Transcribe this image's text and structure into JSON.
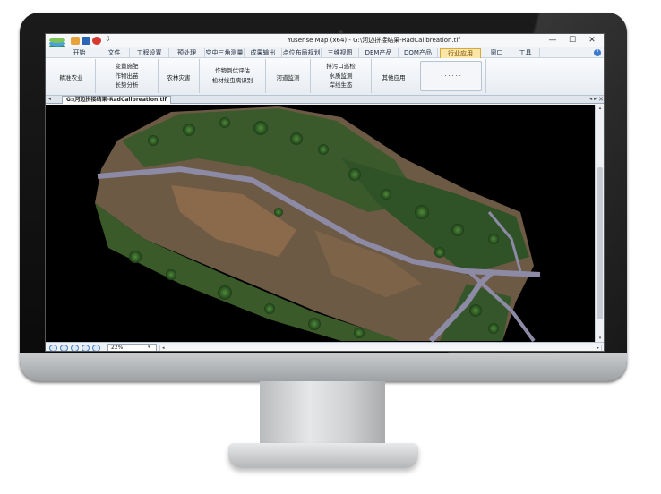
{
  "window": {
    "title": "Yusense Map (x64) - G:\\河边拼接结果-RadCalibreation.tif",
    "min_glyph": "—",
    "max_glyph": "☐",
    "close_glyph": "✕",
    "help_glyph": "?",
    "more_glyph": "⇩"
  },
  "menu_tabs": [
    "开始",
    "文件",
    "工程设置",
    "预处理",
    "空中三角测量",
    "成果输出",
    "点位布局规划",
    "三维视图",
    "DEM产品",
    "DOM产品",
    "行业应用",
    "窗口",
    "工具"
  ],
  "active_tab": "行业应用",
  "ribbon": {
    "precision_agri": "精准农业",
    "variable_fert": "变量施肥",
    "crop_seedling": "作物出苗",
    "growth_analysis": "长势分析",
    "agri_disaster": "农林灾害",
    "lodging_eval": "作物倒伏评估",
    "pine_disease": "松材线虫病识别",
    "river_monitor": "河道监测",
    "outfall_inspect": "排污口巡检",
    "water_quality": "水质监测",
    "shoreline": "岸线生态",
    "other_apps": "其他应用",
    "more": "· · · · · ·"
  },
  "document": {
    "tab_label": "G:\\河边拼接结果-RadCalibreation.tif",
    "left_arrow": "◂",
    "right_arrows": "◂ ▸",
    "close_glyph": "✕"
  },
  "statusbar": {
    "zoom_value": "22%",
    "dropdown_glyph": "▾",
    "left_arrow": "◂",
    "right_arrow": "▸"
  },
  "scrollbar": {
    "up": "▴",
    "down": "▾"
  },
  "icons": [
    "app-logo-icon",
    "folder-icon",
    "save-icon",
    "close-circle-icon",
    "zoom-in-icon",
    "zoom-out-icon",
    "zoom-fit-icon",
    "pan-icon",
    "apple-logo-icon"
  ],
  "colors": {
    "active_tab_bg": "#fbe6a8",
    "canvas_bg": "#000000",
    "road": "#8d8aa6"
  }
}
